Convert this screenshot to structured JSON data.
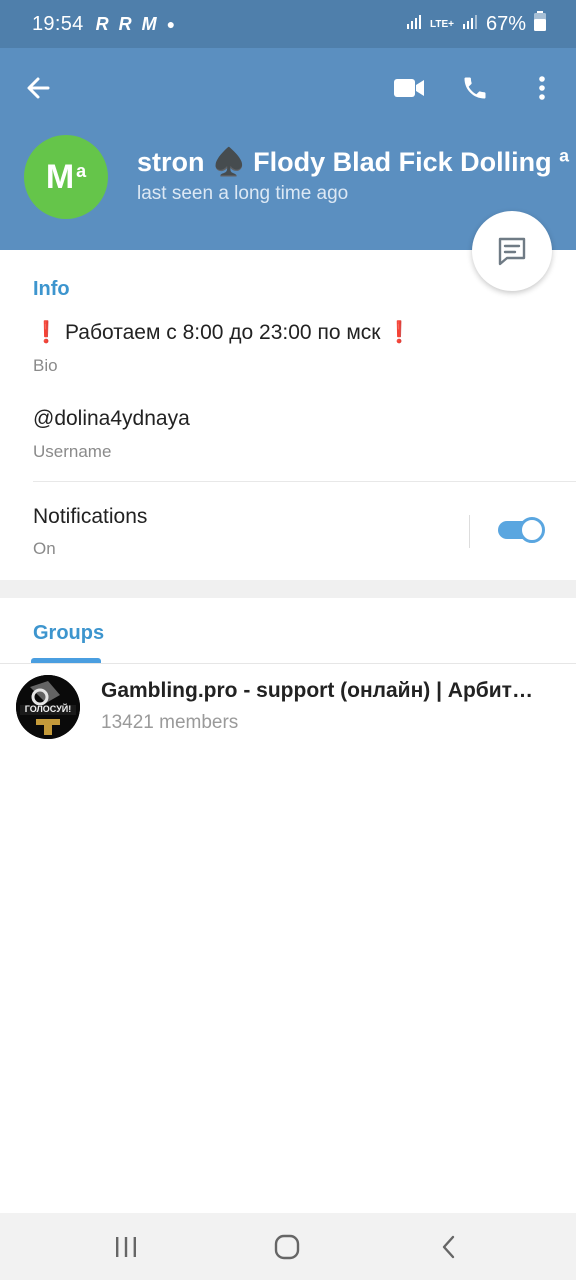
{
  "status_bar": {
    "time": "19:54",
    "notification_icons": [
      "R",
      "R",
      "M"
    ],
    "network": "LTE+",
    "battery": "67%"
  },
  "header": {
    "back_icon": "arrow-left-icon",
    "actions": [
      "video-call-icon",
      "phone-icon",
      "more-vertical-icon"
    ],
    "avatar_initials": "M",
    "avatar_superscript": "a",
    "avatar_color": "#65c54a",
    "name": "stron ♠️ Flody Blad Fick Dolling ª",
    "status": "last seen a long time ago",
    "background_color": "#5b8fc0"
  },
  "fab": {
    "icon": "message-icon"
  },
  "info": {
    "title": "Info",
    "bio": {
      "emoji_left": "❗",
      "text": "Работаем с 8:00 до 23:00 по мск",
      "emoji_right": "❗",
      "label": "Bio"
    },
    "username": {
      "value": "@dolina4ydnaya",
      "label": "Username"
    },
    "notifications": {
      "title": "Notifications",
      "state": "On",
      "enabled": true
    }
  },
  "groups": {
    "tab_label": "Groups",
    "items": [
      {
        "name": "Gambling.pro - support (онлайн) | Арбитраж трафика",
        "members": "13421 members",
        "avatar_text": "ГОЛОСУЙ!"
      }
    ]
  },
  "nav_bar": {
    "buttons": [
      "recent-apps-icon",
      "home-icon",
      "back-icon"
    ]
  }
}
